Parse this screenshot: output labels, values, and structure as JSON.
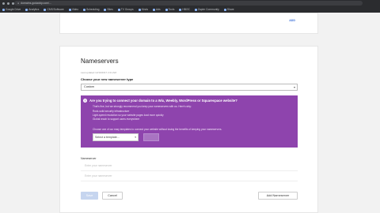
{
  "browser": {
    "url": "domains.godaddy.com/...",
    "bookmarks": [
      "Google Drive",
      "Analytics",
      "CMS/Software",
      "Video",
      "Scheduling",
      "Sites",
      "TV Groups",
      "Kinds",
      "Ads",
      "Tools",
      "HBOC",
      "Zapier Community",
      "Share"
    ]
  },
  "top_card": {
    "add_label": "ADD"
  },
  "nameservers": {
    "title": "Nameservers",
    "last_updated": "Last updated 12/19/2017 2:21 AM",
    "choose_label": "Choose your new nameserver type",
    "selected_type": "Custom",
    "promo": {
      "heading": "Are you trying to connect your domain to a Wix, Weebly, WordPress or Squarespace website?",
      "intro": "That's fine, but we strongly recommend you keep your nameservers with us. Here's why:",
      "bullets": [
        "Rock-solid security infrastructure",
        "Light-speed resolution so your website pages load more quickly",
        "Global reach to support users everywhere"
      ],
      "choose_text": "Choose one of our easy templates to connect your website without losing the benefits of keeping your nameservers.",
      "template_placeholder": "Select a template..."
    },
    "nameserver_label": "Nameserver",
    "input_placeholder": "Enter your nameserver",
    "save_label": "Save",
    "cancel_label": "Cancel",
    "add_nameserver_label": "Add Nameserver"
  }
}
